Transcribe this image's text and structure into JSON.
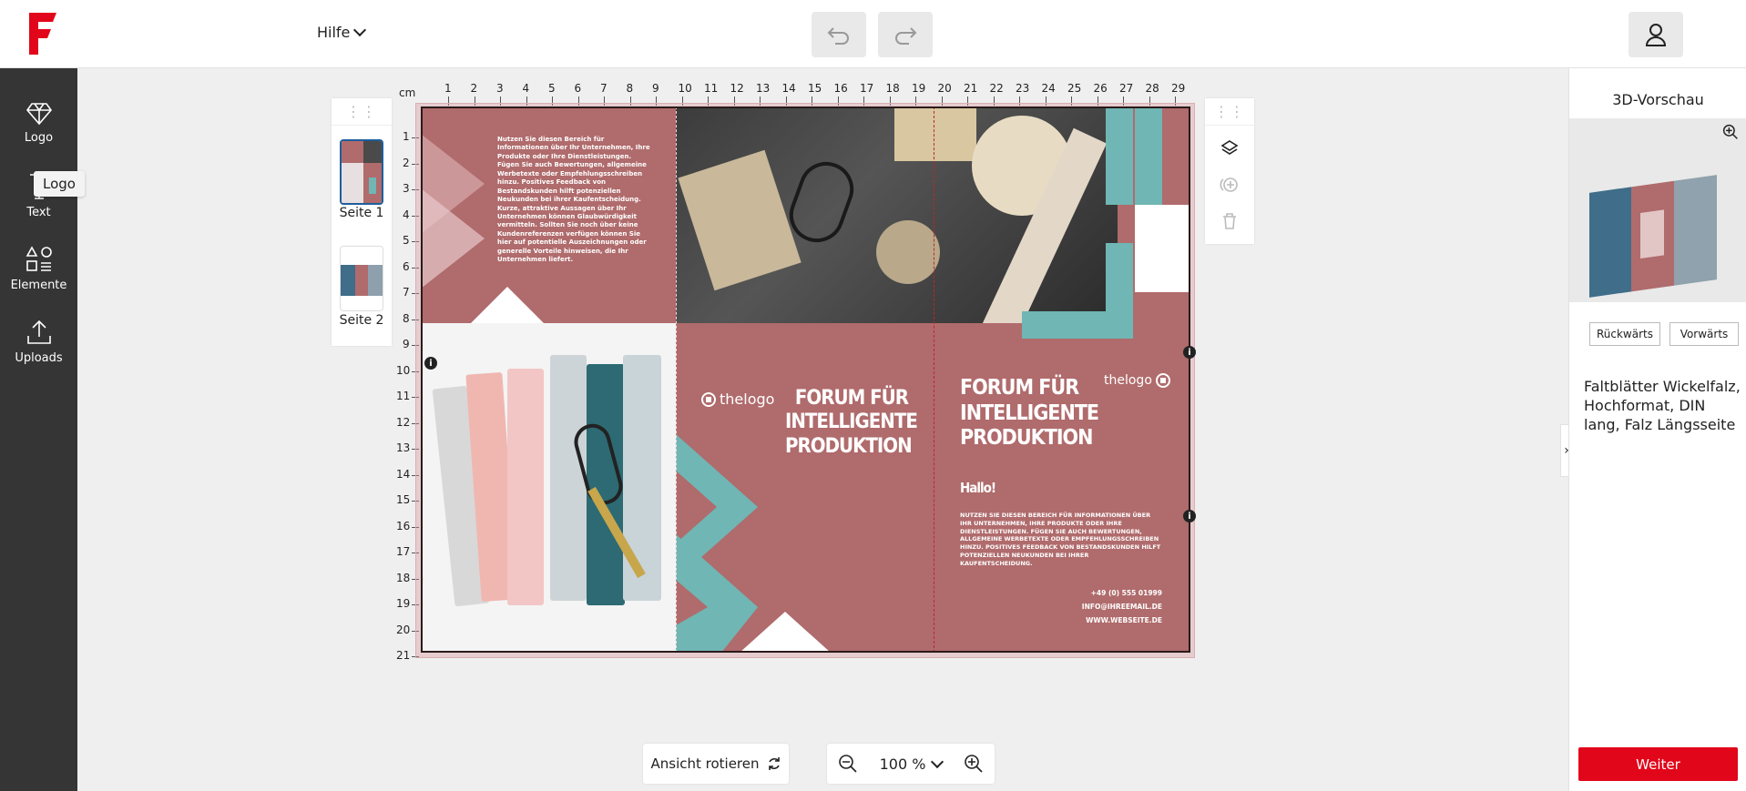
{
  "header": {
    "help_label": "Hilfe"
  },
  "tools": [
    {
      "label": "Logo"
    },
    {
      "label": "Text"
    },
    {
      "label": "Elemente"
    },
    {
      "label": "Uploads"
    }
  ],
  "tooltip": "Logo",
  "pages": [
    {
      "label": "Seite 1"
    },
    {
      "label": "Seite 2"
    }
  ],
  "ruler": {
    "unit": "cm",
    "top": [
      "1",
      "2",
      "3",
      "4",
      "5",
      "6",
      "7",
      "8",
      "9",
      "10",
      "11",
      "12",
      "13",
      "14",
      "15",
      "16",
      "17",
      "18",
      "19",
      "20",
      "21",
      "22",
      "23",
      "24",
      "25",
      "26",
      "27",
      "28",
      "29"
    ],
    "left": [
      "1",
      "2",
      "3",
      "4",
      "5",
      "6",
      "7",
      "8",
      "9",
      "10",
      "11",
      "12",
      "13",
      "14",
      "15",
      "16",
      "17",
      "18",
      "19",
      "20",
      "21"
    ]
  },
  "canvas": {
    "panel1_text": "Nutzen Sie diesen Bereich für Informationen über Ihr Unternehmen, Ihre Produkte oder Ihre Dienstleistungen. Fügen Sie auch Bewertungen, allgemeine Werbetexte oder Empfehlungsschreiben hinzu. Positives Feedback von Bestandskunden hilft potenziellen Neukunden bei ihrer Kaufentscheidung. Kurze, attraktive Aussagen über Ihr Unternehmen können Glaubwürdigkeit vermitteln. Sollten Sie noch über keine Kundenreferenzen verfügen können Sie hier auf potentielle Auszeichnungen oder generelle Vorteile hinweisen, die Ihr Unternehmen liefert.",
    "logo_text": "thelogo",
    "headline_left": "FORUM FÜR INTELLIGENTE PRODUKTION",
    "headline_right": "FORUM FÜR INTELLIGENTE PRODUKTION",
    "hello": "Hallo!",
    "body_right": "NUTZEN SIE DIESEN BEREICH FÜR INFORMATIONEN ÜBER IHR UNTERNEHMEN, IHRE PRODUKTE ODER IHRE DIENSTLEISTUNGEN. FÜGEN SIE AUCH BEWERTUNGEN, ALLGEMEINE WERBETEXTE ODER EMPFEHLUNGSSCHREIBEN HINZU. POSITIVES FEEDBACK VON BESTANDSKUNDEN HILFT POTENZIELLEN NEUKUNDEN BEI IHRER KAUFENTSCHEIDUNG.",
    "phone": "+49 (0) 555 01999",
    "email": "INFO@IHREEMAIL.DE",
    "web": "WWW.WEBSEITE.DE",
    "colors": {
      "rose": "#b06b6c",
      "teal": "#6fb6b4"
    }
  },
  "bottom": {
    "rotate_label": "Ansicht rotieren",
    "zoom_value": "100 %"
  },
  "sidebar": {
    "title": "3D-Vorschau",
    "back_label": "Rückwärts",
    "forward_label": "Vorwärts",
    "product": "Faltblätter Wickelfalz, Hochformat, DIN lang, Falz Längsseite",
    "next_label": "Weiter"
  }
}
